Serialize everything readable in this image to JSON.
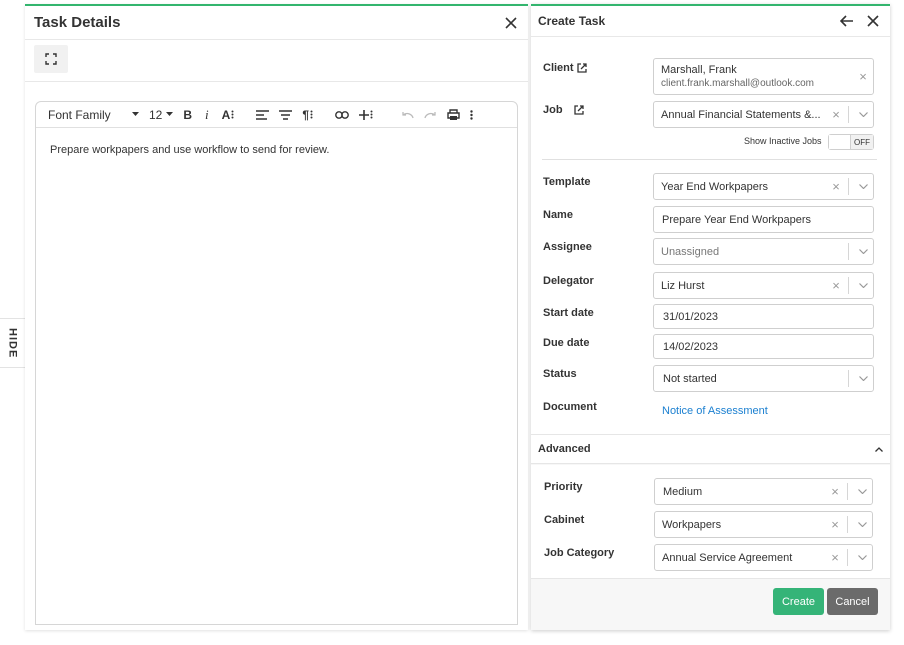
{
  "side_tab": {
    "label": "HIDE"
  },
  "task_details": {
    "title": "Task Details",
    "editor": {
      "toolbar": {
        "font_family": "Font Family",
        "font_size": "12",
        "bold": "B",
        "italic": "i",
        "text_size": "A",
        "paragraph": "¶"
      },
      "content": "Prepare workpapers and use workflow to send for review."
    }
  },
  "create_task": {
    "title": "Create Task",
    "client": {
      "label": "Client",
      "name": "Marshall, Frank",
      "email": "client.frank.marshall@outlook.com"
    },
    "job": {
      "label": "Job",
      "value": "Annual Financial Statements &..."
    },
    "show_inactive_jobs": {
      "label": "Show Inactive Jobs",
      "state": "OFF"
    },
    "template": {
      "label": "Template",
      "value": "Year End Workpapers"
    },
    "name": {
      "label": "Name",
      "value": "Prepare Year End Workpapers"
    },
    "assignee": {
      "label": "Assignee",
      "value": "Unassigned"
    },
    "delegator": {
      "label": "Delegator",
      "value": "Liz Hurst"
    },
    "start_date": {
      "label": "Start date",
      "value": "31/01/2023"
    },
    "due_date": {
      "label": "Due date",
      "value": "14/02/2023"
    },
    "status": {
      "label": "Status",
      "value": "Not started"
    },
    "document": {
      "label": "Document",
      "value": "Notice of Assessment"
    },
    "advanced": {
      "title": "Advanced",
      "priority": {
        "label": "Priority",
        "value": "Medium"
      },
      "cabinet": {
        "label": "Cabinet",
        "value": "Workpapers"
      },
      "job_category": {
        "label": "Job Category",
        "value": "Annual Service Agreement"
      }
    },
    "buttons": {
      "create": "Create",
      "cancel": "Cancel"
    }
  },
  "colors": {
    "accent": "#33b56e",
    "link": "#1a7fd0",
    "create_button": "#35b478",
    "cancel_button": "#6b6b6b"
  }
}
